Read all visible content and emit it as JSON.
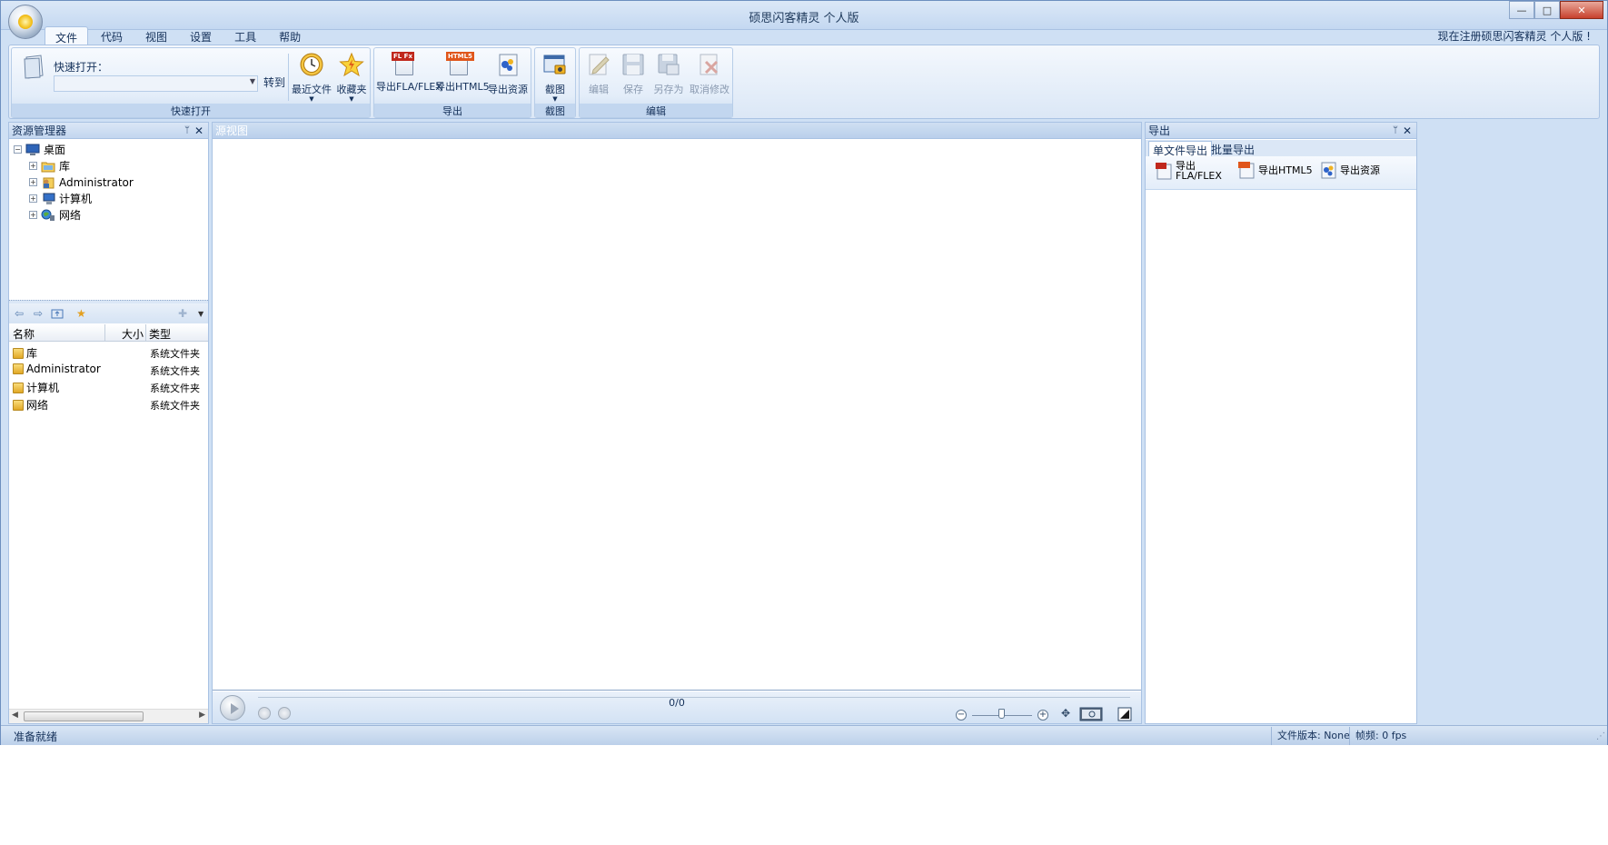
{
  "window": {
    "title": "硕思闪客精灵 个人版",
    "controls": {
      "minimize": "—",
      "maximize": "□",
      "close": "✕"
    }
  },
  "menu": {
    "tabs": [
      "文件",
      "代码",
      "视图",
      "设置",
      "工具",
      "帮助"
    ],
    "active_tab": "文件",
    "register_link": "现在注册硕思闪客精灵 个人版 !"
  },
  "ribbon": {
    "quick_open": {
      "label": "快速打开：",
      "input_value": "",
      "goto": "转到",
      "recent_files": "最近文件",
      "favorites": "收藏夹",
      "group_label": "快速打开"
    },
    "export": {
      "fla_flex": "导出FLA/FLEX",
      "html5": "导出HTML5",
      "resources": "导出资源",
      "group_label": "导出",
      "fla_tag": "FL Fx",
      "html5_tag": "HTML5"
    },
    "screenshot": {
      "label": "截图",
      "group_label": "截图"
    },
    "edit": {
      "edit": "编辑",
      "save": "保存",
      "save_as": "另存为",
      "cancel": "取消修改",
      "group_label": "编辑"
    }
  },
  "explorer": {
    "title": "资源管理器",
    "tree": [
      {
        "label": "桌面",
        "icon": "desktop-icon",
        "expander": "−"
      },
      {
        "label": "库",
        "icon": "library-icon",
        "expander": "+"
      },
      {
        "label": "Administrator",
        "icon": "user-icon",
        "expander": "+"
      },
      {
        "label": "计算机",
        "icon": "computer-icon",
        "expander": "+"
      },
      {
        "label": "网络",
        "icon": "network-icon",
        "expander": "+"
      }
    ],
    "list_columns": {
      "name": "名称",
      "size": "大小",
      "type": "类型"
    },
    "list_rows": [
      {
        "name": "库",
        "type": "系统文件夹"
      },
      {
        "name": "Administrator",
        "type": "系统文件夹"
      },
      {
        "name": "计算机",
        "type": "系统文件夹"
      },
      {
        "name": "网络",
        "type": "系统文件夹"
      }
    ]
  },
  "source_view": {
    "title": "源视图",
    "frame_counter": "0/0"
  },
  "export_panel": {
    "title": "导出",
    "tabs": [
      "单文件导出",
      "批量导出"
    ],
    "active_tab": "单文件导出",
    "buttons": {
      "fla_line1": "导出",
      "fla_line2": "FLA/FLEX",
      "html5": "导出HTML5",
      "resources": "导出资源"
    }
  },
  "statusbar": {
    "ready": "准备就绪",
    "file_version": "文件版本: None",
    "fps": "帧频: 0 fps"
  },
  "colors": {
    "frame_blue": "#cfe0f4",
    "ribbon_border": "#a9c2e3",
    "text_navy": "#15315a"
  }
}
